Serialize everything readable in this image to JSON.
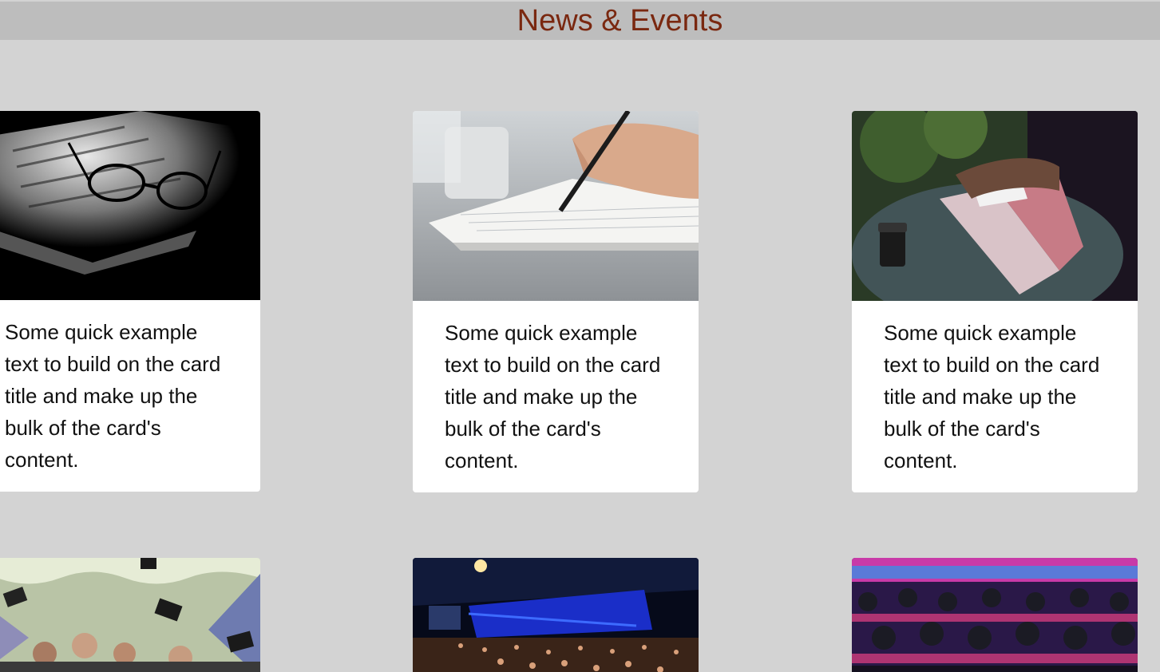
{
  "header": {
    "title": "News & Events"
  },
  "cards": [
    {
      "image": "newspaper-glasses-photo",
      "text": "Some quick example text to build on the card title and make up the bulk of the card's content."
    },
    {
      "image": "hand-writing-notebook-photo",
      "text": "Some quick example text to build on the card title and make up the bulk of the card's content."
    },
    {
      "image": "laptop-coffee-notes-photo",
      "text": "Some quick example text to build on the card title and make up the bulk of the card's content."
    },
    {
      "image": "graduation-caps-photo"
    },
    {
      "image": "conference-hall-photo"
    },
    {
      "image": "audience-seats-photo"
    }
  ],
  "colors": {
    "background": "#d3d3d3",
    "header_bar": "#bdbdbd",
    "title": "#7a2810",
    "card": "#ffffff"
  }
}
